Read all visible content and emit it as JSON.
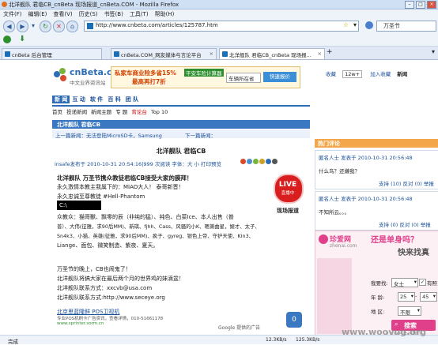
{
  "window": {
    "title": "北洋舰队 君临CB_cnBeta 现场报道_cnBeta.COM - Mozilla Firefox"
  },
  "menu": [
    "文件(F)",
    "编辑(E)",
    "查看(V)",
    "历史(S)",
    "书签(B)",
    "工具(T)",
    "帮助(H)"
  ],
  "toolbar": {
    "url": "http://www.cnbeta.com/articles/125787.htm",
    "search_placeholder": "万圣节"
  },
  "tabs": [
    {
      "label": "cnBeta 后台管理",
      "active": false
    },
    {
      "label": "cnBeta.COM_网友媒体与言论平台",
      "active": false
    },
    {
      "label": "北洋舰队 君临CB_cnBeta 现场报...",
      "active": true
    }
  ],
  "site": {
    "logo": "cnBeta.com",
    "logo_sub": "中文业界资讯站",
    "ad_text1": "私家车商业险多省15%",
    "ad_text2": "最高再打7折",
    "ad_text3": "平安车险计算器",
    "ad_input_placeholder": "车辆所在省",
    "ad_button": "快速报价",
    "right_links": [
      "收藏",
      "12w+",
      "加入收藏",
      "新闻"
    ]
  },
  "nav": {
    "tabs": [
      "新 闻",
      "互 动",
      "软 件",
      "百 科",
      "团 队"
    ],
    "subnav": [
      "首页",
      "投递新闻",
      "新闻主题",
      "专 题",
      "背论台",
      "Top 10"
    ]
  },
  "section": {
    "title": "北洋舰队 君临CB",
    "prev": "上一篇新闻：无法登陆MicroSD卡，Samsung",
    "next": "下一篇新闻："
  },
  "article": {
    "title": "北洋舰队 君临CB",
    "meta": "insafe发布于 2010-10-31 20:54:16|999 次阅读 字体：大 小 打印预览",
    "headline": "北洋舰队 万圣节携众教徒君临CB接受大家的膜拜！",
    "lines": [
      "永久激情本教主我属下的：MIAO大人！ 泰哥新晋！",
      "永久忠诚至尊教徒 #Hell-Phantom",
      "众教众：猫哥獸、飘零的辰（非纯的猛）、纯色、白菜Ice、本人出售（普",
      "普）、大伟(征雅，求90后MM)、新琪、fjhh、Cass、风骚的小K、嗯萧曲星，娱才、太子、",
      "Sn4k3、小猫、英雄(征雅，求90后MM)、疯子、gyreg、银色上帝、守护天使、Kin3、",
      "Liange、面包、微笑制造、紫夜、夏天。",
      "万圣节的晚上，CB也闹鬼了！",
      "北洋舰队将搞大家在最后两个月的世界鸡的妹滴盆！",
      "北洋舰队联系方式：xxcvb@usa.com",
      "北洋舰队联系方式:http://www.seceye.org"
    ],
    "code_label": "C:\\",
    "live_badge": "LIVE",
    "live_sub": "直播中",
    "live_caption": "现场报道",
    "footer_link": "北京思蓝隆鲜 POS卫视机",
    "footer_sub": "专业POS机刷卡广告资讯，查看详情，010-51661178",
    "footer_url": "www.sprinter.sorm.cn",
    "google_ad": "Google 提供的广告",
    "vote_count": "0"
  },
  "sidebar": {
    "hot_title": "热门评论",
    "comments": [
      {
        "meta": "匿名人士 发表于 2010-10-31 20:56:48",
        "text": "什么鸟？还嫌我？",
        "actions": [
          "支持 (10)",
          "反对 (0)",
          "举报"
        ]
      },
      {
        "meta": "匿名人士 发表于 2010-10-31 20:56:48",
        "text": "不知所云。。。",
        "actions": [
          "支持 (0)",
          "反对 (0)",
          "举报"
        ]
      }
    ],
    "ad_brand": "珍爱网",
    "ad_domain": "zhenai.com",
    "ad_slogan1": "还是单身吗？",
    "ad_slogan2": "快来找真",
    "ad_form": {
      "seek_label": "我要找:",
      "seek_value": "女士",
      "has_photo": "有照",
      "age_label": "年 龄:",
      "age_from": "25",
      "age_to": "45",
      "region_label": "地 区:",
      "region_value": "不限"
    },
    "ad_button": "搜索",
    "ad_footer": "2100万会员等你"
  },
  "status": {
    "text": "完成",
    "down": "12.3KB/s",
    "up": "125.3KB/s"
  },
  "watermark": "www.woovug.org"
}
